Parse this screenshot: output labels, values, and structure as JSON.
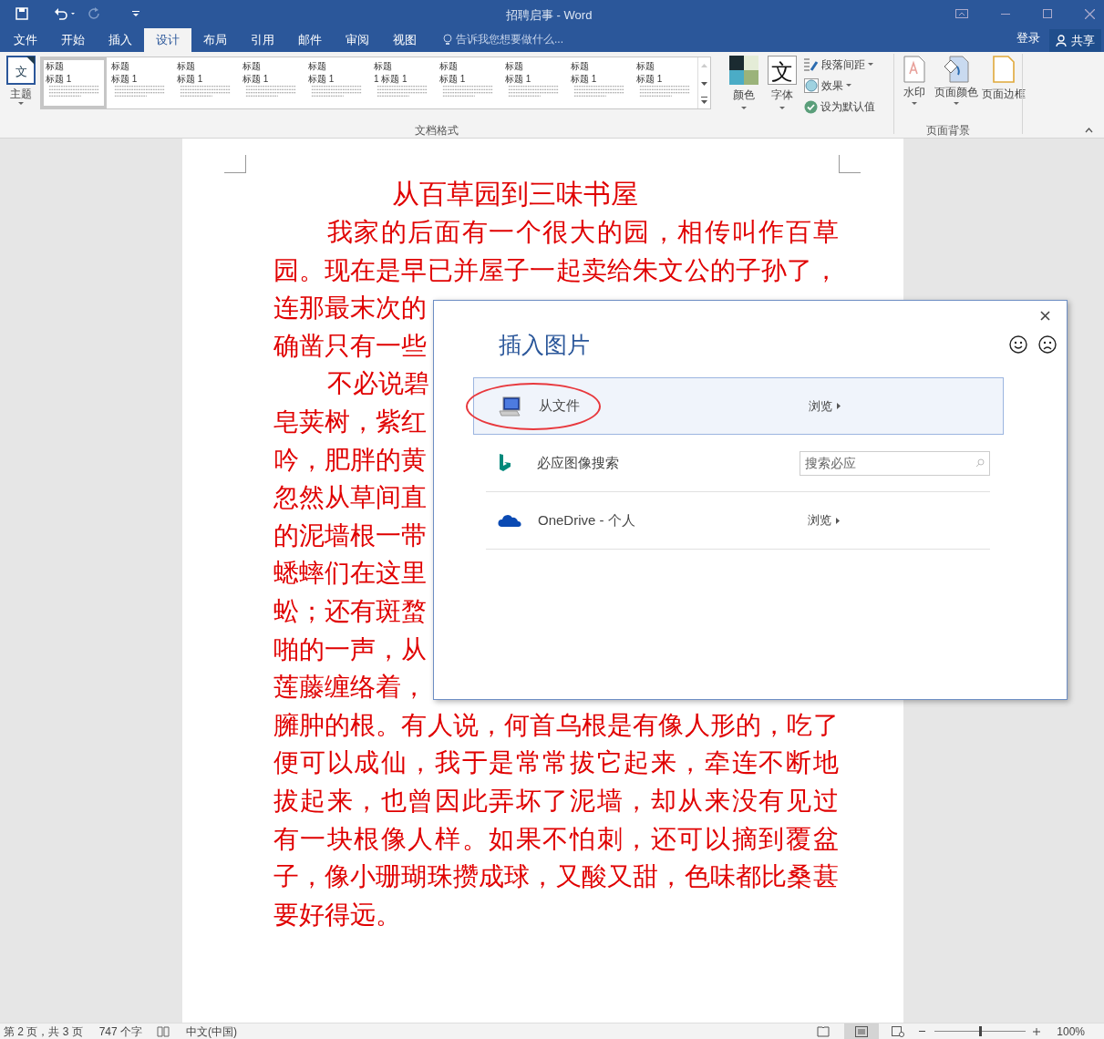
{
  "window": {
    "title": "招聘启事 - Word"
  },
  "menu_tabs": [
    {
      "label": "文件",
      "selected": false
    },
    {
      "label": "开始",
      "selected": false
    },
    {
      "label": "插入",
      "selected": false
    },
    {
      "label": "设计",
      "selected": true
    },
    {
      "label": "布局",
      "selected": false
    },
    {
      "label": "引用",
      "selected": false
    },
    {
      "label": "邮件",
      "selected": false
    },
    {
      "label": "审阅",
      "selected": false
    },
    {
      "label": "视图",
      "selected": false
    }
  ],
  "tell_me": {
    "placeholder": "告诉我您想要做什么..."
  },
  "account": {
    "sign_in": "登录",
    "share": "共享"
  },
  "ribbon": {
    "theme_icon_glyph": "文",
    "fonts_icon_glyph": "文",
    "theme_button": "主题",
    "styles": [
      {
        "title": "标题",
        "heading": "标题 1",
        "selected": true
      },
      {
        "title": "标题",
        "heading": "标题 1",
        "selected": false
      },
      {
        "title": "标题",
        "heading": "标题 1",
        "selected": false
      },
      {
        "title": "标题",
        "heading": "标题 1",
        "selected": false
      },
      {
        "title": "标题",
        "heading": "标题 1",
        "selected": false
      },
      {
        "title": "标题",
        "heading": "1 标题 1",
        "selected": false
      },
      {
        "title": "标题",
        "heading": "标题 1",
        "selected": false
      },
      {
        "title": "标题",
        "heading": "标题 1",
        "selected": false
      },
      {
        "title": "标题",
        "heading": "标题 1",
        "selected": false
      },
      {
        "title": "标题",
        "heading": "标题 1",
        "selected": false
      }
    ],
    "colors_button": "颜色",
    "fonts_button": "字体",
    "paragraph_spacing": "段落间距",
    "effects": "效果",
    "set_default": "设为默认值",
    "group_format": "文档格式",
    "watermark": "水印",
    "page_color": "页面颜色",
    "page_borders": "页面边框",
    "group_background": "页面背景"
  },
  "document": {
    "title": "从百草园到三味书屋",
    "lines": [
      {
        "text": "我家的后面有一个很大的园，相传叫作百草",
        "indent": true,
        "kind": "full"
      },
      {
        "text": "园。现在是早已并屋子一起卖给朱文公的子孙了，",
        "indent": false,
        "kind": "full"
      },
      {
        "text": "连那最末次的",
        "indent": false,
        "kind": "partial"
      },
      {
        "text": "确凿只有一些",
        "indent": false,
        "kind": "partial"
      },
      {
        "text": "不必说碧",
        "indent": true,
        "kind": "partial"
      },
      {
        "text": "皂荚树，紫红",
        "indent": false,
        "kind": "partial"
      },
      {
        "text": "吟，肥胖的黄",
        "indent": false,
        "kind": "partial"
      },
      {
        "text": "忽然从草间直",
        "indent": false,
        "kind": "partial"
      },
      {
        "text": "的泥墙根一带",
        "indent": false,
        "kind": "partial"
      },
      {
        "text": "蟋蟀们在这里",
        "indent": false,
        "kind": "partial"
      },
      {
        "text": "蚣；还有斑蝥",
        "indent": false,
        "kind": "partial"
      },
      {
        "text": "啪的一声，从",
        "indent": false,
        "kind": "partial"
      },
      {
        "text": "莲藤缠络着，",
        "indent": false,
        "kind": "partial"
      },
      {
        "text": "臃肿的根。有人说，何首乌根是有像人形的，吃了",
        "indent": false,
        "kind": "full"
      },
      {
        "text": "便可以成仙，我于是常常拔它起来，牵连不断地",
        "indent": false,
        "kind": "full"
      },
      {
        "text": "拔起来，也曾因此弄坏了泥墙，却从来没有见过",
        "indent": false,
        "kind": "full"
      },
      {
        "text": "有一块根像人样。如果不怕刺，还可以摘到覆盆",
        "indent": false,
        "kind": "full"
      },
      {
        "text": "子，像小珊瑚珠攒成球，又酸又甜，色味都比桑葚",
        "indent": false,
        "kind": "full"
      },
      {
        "text": "要好得远。",
        "indent": false,
        "kind": "partial"
      }
    ]
  },
  "dialog": {
    "title": "插入图片",
    "sources": [
      {
        "kind": "file",
        "label": "从文件",
        "action": "浏览",
        "selected": true
      },
      {
        "kind": "search",
        "label": "必应图像搜索",
        "placeholder": "搜索必应",
        "selected": false
      },
      {
        "kind": "cloud",
        "label": "OneDrive - 个人",
        "action": "浏览",
        "selected": false
      }
    ]
  },
  "status_bar": {
    "page": "第 2 页，共 3 页",
    "words": "747 个字",
    "language": "中文(中国)",
    "zoom": "100%",
    "zoom_slider": {
      "level": 0.5
    }
  }
}
